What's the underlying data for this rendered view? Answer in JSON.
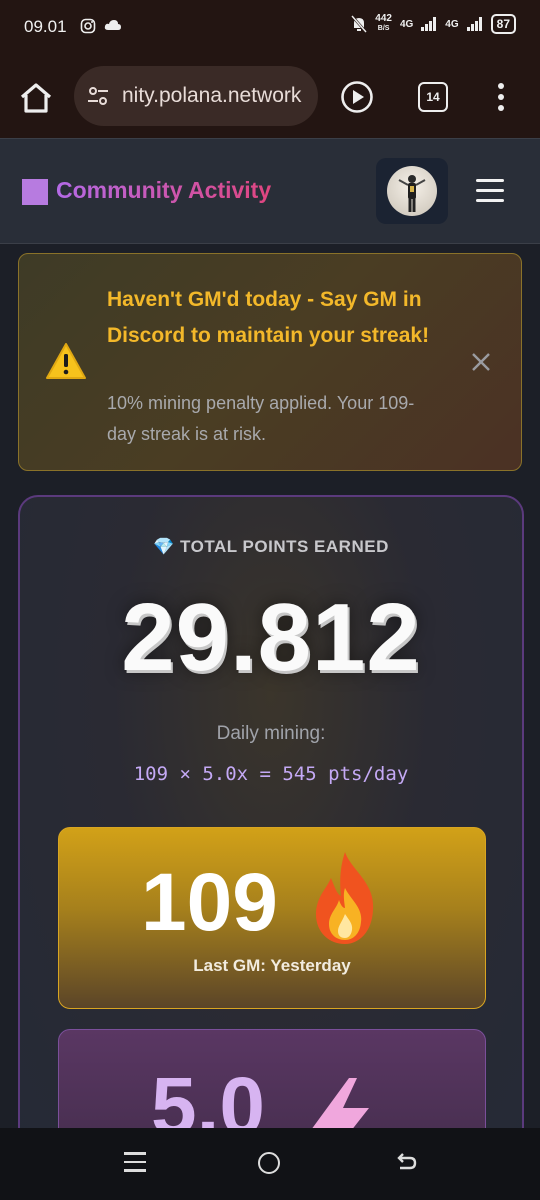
{
  "status_bar": {
    "time": "09.01",
    "speed_value": "442",
    "speed_unit": "B/S",
    "net_a": "4G",
    "net_b": "4G",
    "battery": "87"
  },
  "browser": {
    "url": "nity.polana.network",
    "tab_count": "14"
  },
  "header": {
    "title": "Community Activity"
  },
  "alert": {
    "title": "Haven't GM'd today - Say GM in Discord to maintain your streak!",
    "body": "10% mining penalty applied. Your 109-day streak is at risk."
  },
  "points": {
    "label": "💎 TOTAL POINTS EARNED",
    "value": "29.812",
    "daily_label": "Daily mining:",
    "formula": "109 × 5.0x = 545 pts/day"
  },
  "streak": {
    "value": "109",
    "subtitle": "Last GM: Yesterday"
  },
  "multiplier": {
    "value": "5.0"
  },
  "colors": {
    "accent_purple": "#b77be0",
    "alert_yellow": "#f3b82a",
    "streak_gold": "#d2a118"
  }
}
